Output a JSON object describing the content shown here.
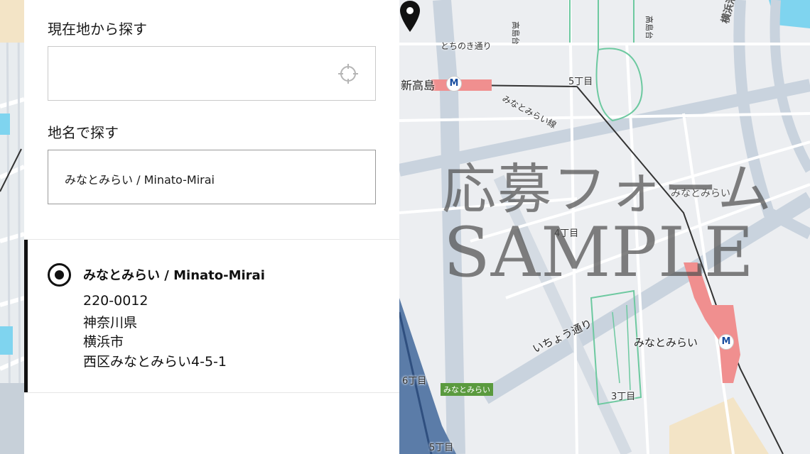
{
  "search": {
    "current_location_label": "現在地から探す",
    "current_location_value": "",
    "place_name_label": "地名で探す",
    "place_name_value": "みなとみらい / Minato-Mirai"
  },
  "result": {
    "title": "みなとみらい / Minato-Mirai",
    "postal_code": "220-0012",
    "prefecture": "神奈川県",
    "city": "横浜市",
    "street": "西区みなとみらい4-5-1",
    "selected": true
  },
  "map": {
    "labels": {
      "shintakashima": "新高島",
      "tochinoki": "とちのき通り",
      "chome5": "5丁目",
      "line": "みなとみらい線",
      "minatomirai_area": "みなとみらい",
      "chome4": "4丁目",
      "icho": "いちょう通り",
      "minatomirai_station": "みなとみらい",
      "chome3": "3丁目",
      "chome6": "6丁目",
      "chome5b": "5丁目",
      "green_label": "みなとみらい",
      "highway": "横浜港湾線",
      "takashima1": "高島台",
      "takashima2": "高島台"
    },
    "metro_symbol": "M",
    "watermark_jp": "応募フォーム",
    "watermark_en": "SAMPLE"
  },
  "icons": {
    "locate": "crosshair-locate-icon",
    "pin": "map-pin-icon",
    "radio": "radio-selected-icon"
  },
  "colors": {
    "road": "#ffffff",
    "road_major": "#c9d3de",
    "park_lines": "#6dc9a0",
    "rail_highlight": "#f08f8f",
    "water": "#7fd4ef",
    "panel_bg": "#ffffff"
  }
}
